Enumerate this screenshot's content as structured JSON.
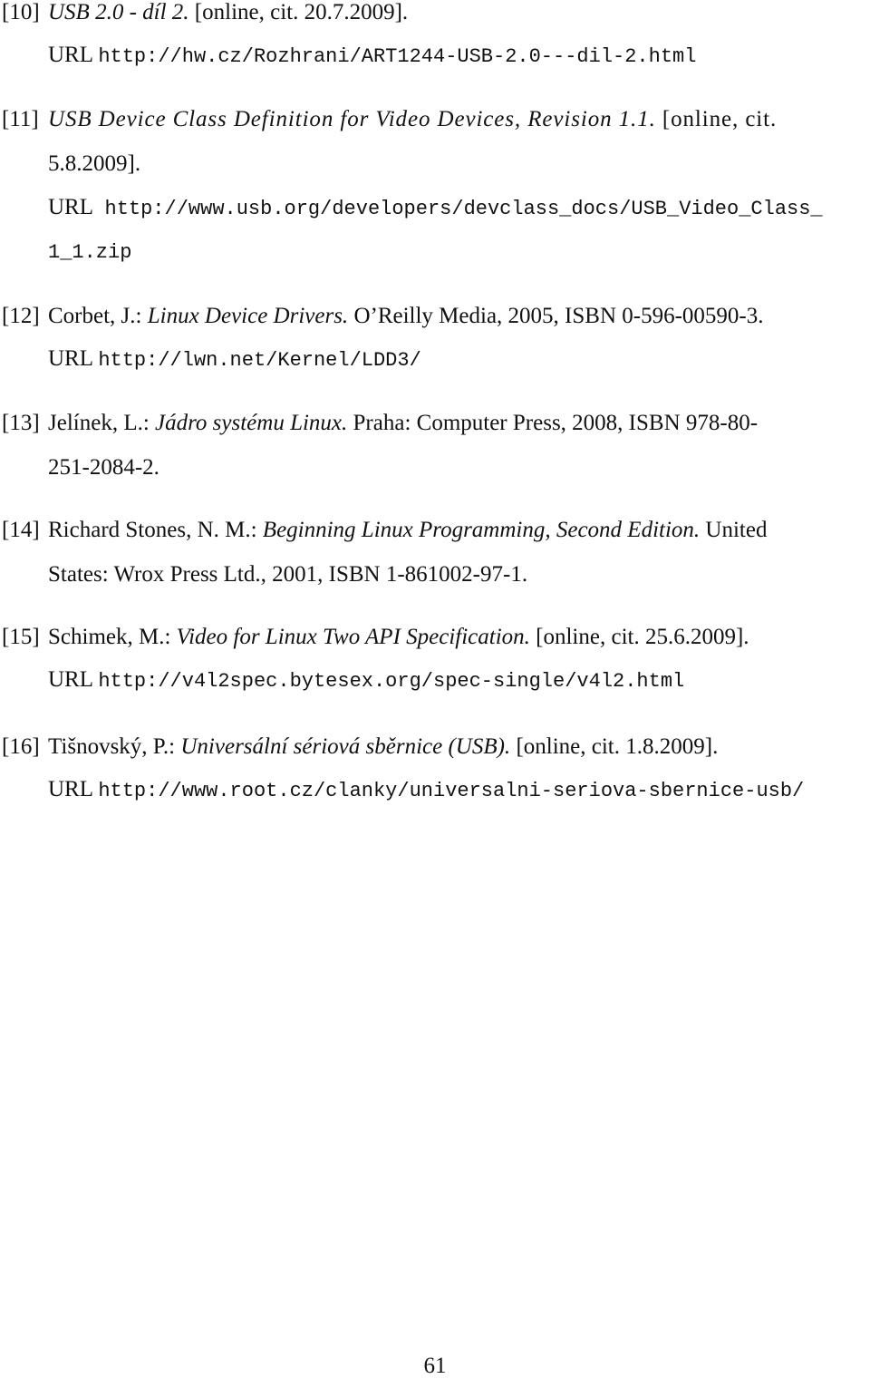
{
  "references": [
    {
      "number": "[10]",
      "title": "USB 2.0 - díl 2.",
      "rest": " [online, cit. 20.7.2009].",
      "url_label": "URL",
      "url": "http://hw.cz/Rozhrani/ART1244-USB-2.0---dil-2.html"
    },
    {
      "number": "[11]",
      "title": "USB Device Class Definition for Video Devices, Revision 1.1.",
      "rest": " [online, cit.",
      "cont": "5.8.2009].",
      "url_label": "URL",
      "url": "http://www.usb.org/developers/devclass_docs/USB_Video_Class_",
      "url_cont": "1_1.zip"
    },
    {
      "number": "[12]",
      "author": "Corbet, J.: ",
      "title": "Linux Device Drivers.",
      "rest": " O’Reilly Media, 2005, ISBN 0-596-00590-3.",
      "url_label": "URL",
      "url": "http://lwn.net/Kernel/LDD3/"
    },
    {
      "number": "[13]",
      "author": "Jelínek, L.: ",
      "title": "Jádro systému Linux.",
      "rest": " Praha: Computer Press, 2008, ISBN 978-80-",
      "cont": "251-2084-2."
    },
    {
      "number": "[14]",
      "author": "Richard Stones, N. M.: ",
      "title": "Beginning Linux Programming, Second Edition.",
      "rest": " United",
      "cont": "States: Wrox Press Ltd., 2001, ISBN 1-861002-97-1."
    },
    {
      "number": "[15]",
      "author": "Schimek, M.: ",
      "title": "Video for Linux Two API Specification.",
      "rest": " [online, cit. 25.6.2009].",
      "url_label": "URL",
      "url": "http://v4l2spec.bytesex.org/spec-single/v4l2.html"
    },
    {
      "number": "[16]",
      "author": "Tišnovský, P.: ",
      "title": "Universální sériová sběrnice (USB).",
      "rest": " [online, cit. 1.8.2009].",
      "url_label": "URL",
      "url": "http://www.root.cz/clanky/universalni-seriova-sbernice-usb/"
    }
  ],
  "page_number": "61"
}
